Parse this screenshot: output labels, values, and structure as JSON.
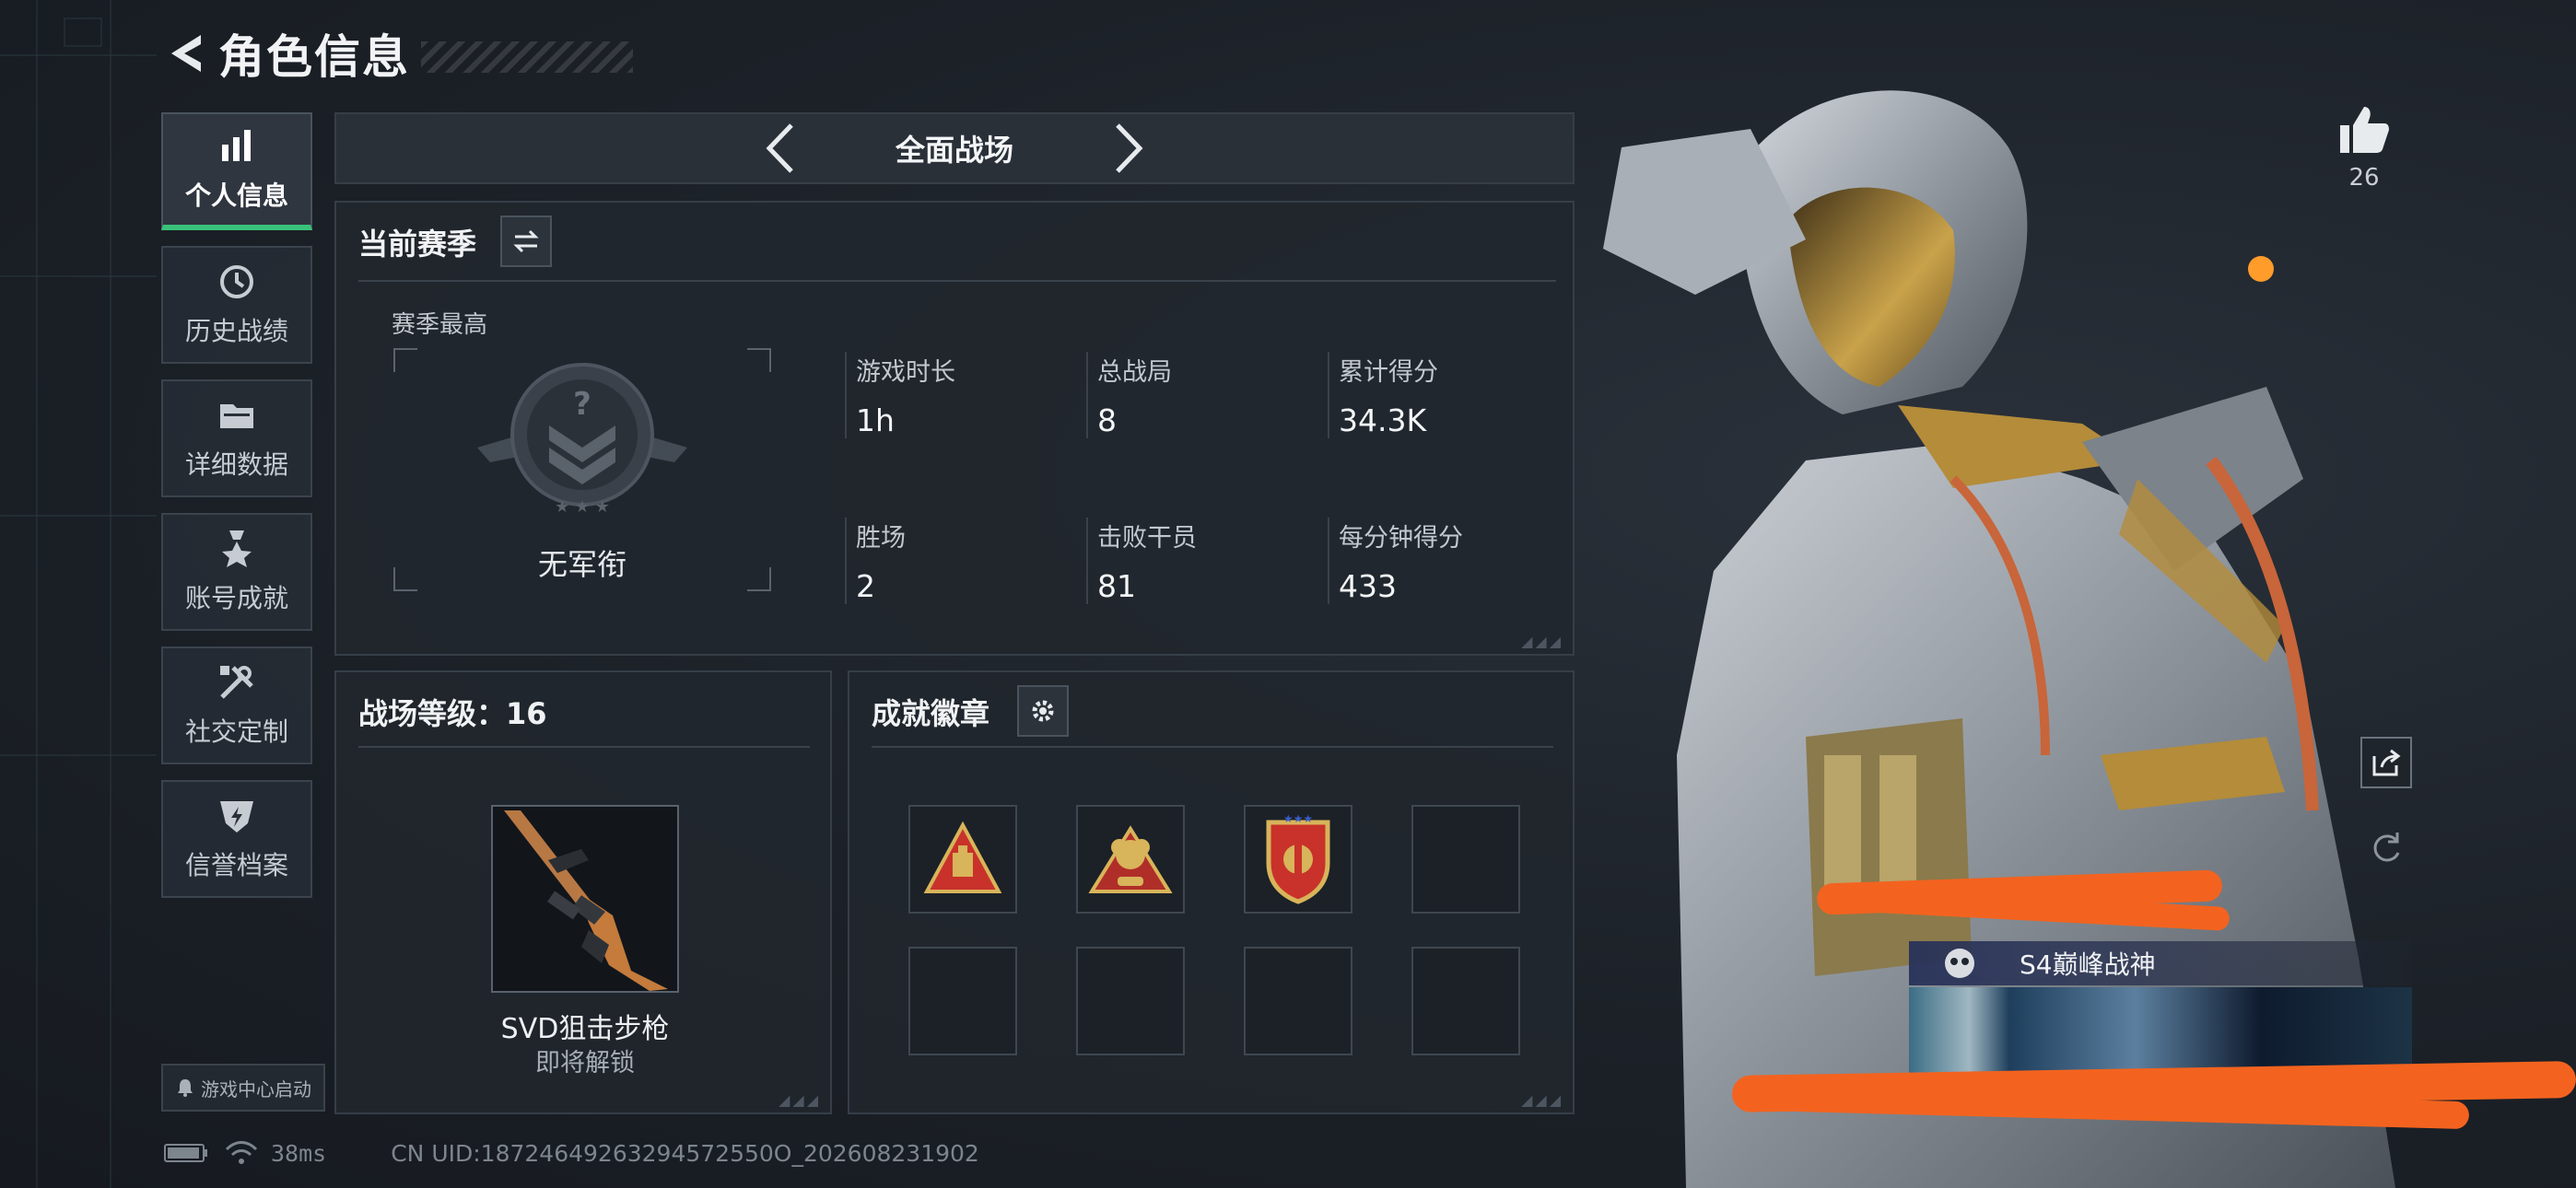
{
  "header": {
    "title": "角色信息"
  },
  "sidebar": {
    "items": [
      {
        "label": "个人信息",
        "icon": "bar-chart-icon",
        "active": true
      },
      {
        "label": "历史战绩",
        "icon": "history-icon"
      },
      {
        "label": "详细数据",
        "icon": "folder-icon"
      },
      {
        "label": "账号成就",
        "icon": "medal-icon"
      },
      {
        "label": "社交定制",
        "icon": "tools-icon"
      },
      {
        "label": "信誉档案",
        "icon": "shield-icon"
      }
    ],
    "game_center": "游戏中心启动"
  },
  "mode": {
    "name": "全面战场"
  },
  "season": {
    "title": "当前赛季",
    "best_label": "赛季最高",
    "rank_name": "无军衔",
    "stats": [
      {
        "key": "游戏时长",
        "value": "1h"
      },
      {
        "key": "总战局",
        "value": "8"
      },
      {
        "key": "累计得分",
        "value": "34.3K"
      },
      {
        "key": "胜场",
        "value": "2"
      },
      {
        "key": "击败干员",
        "value": "81"
      },
      {
        "key": "每分钟得分",
        "value": "433"
      }
    ]
  },
  "level": {
    "title": "战场等级：16",
    "weapon_name": "SVD狙击步枪",
    "weapon_sub": "即将解锁"
  },
  "badges": {
    "title": "成就徽章"
  },
  "character": {
    "likes": "26",
    "banner_text": "S4巅峰战神"
  },
  "status": {
    "ping": "38ms",
    "uid": "CN UID:18724649263294572550O_202608231902"
  },
  "colors": {
    "accent": "#39c27a",
    "scribble": "#f3631f"
  }
}
